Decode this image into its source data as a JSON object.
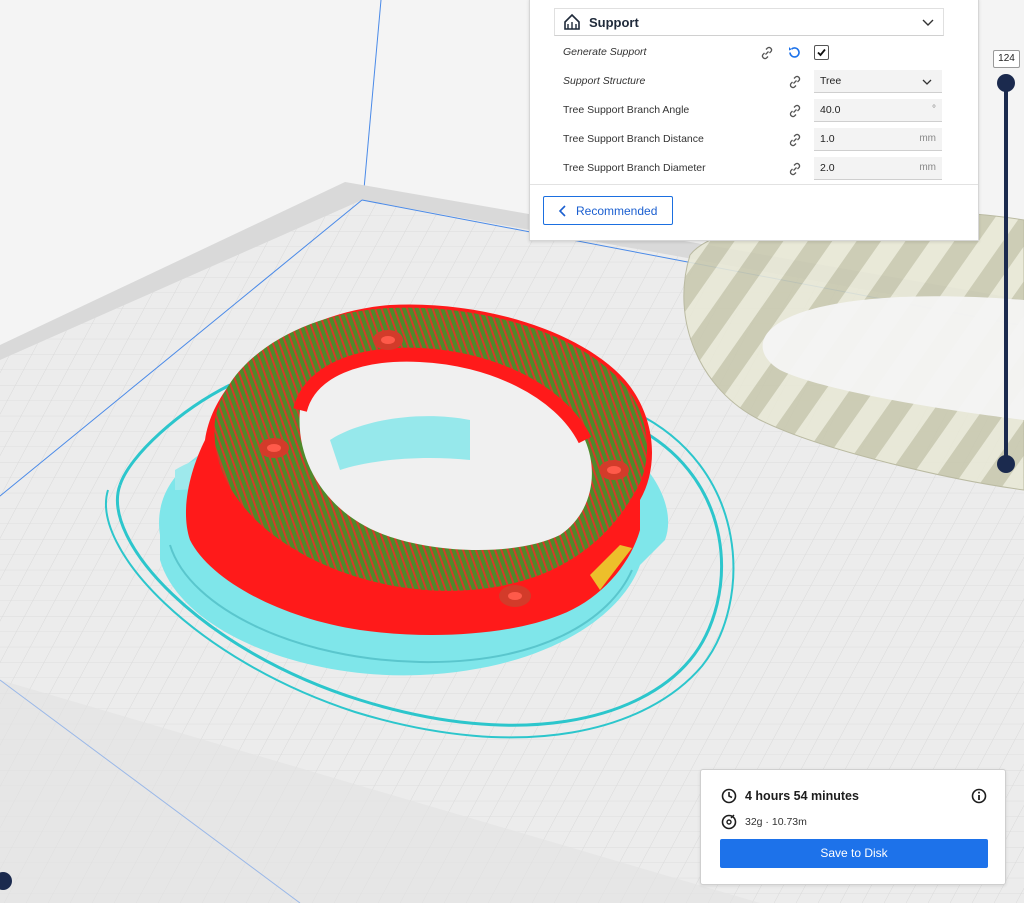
{
  "support_section": {
    "title": "Support",
    "icon": "support-icon",
    "settings": [
      {
        "label": "Generate Support",
        "italic": true,
        "type": "checkbox",
        "checked": true
      },
      {
        "label": "Support Structure",
        "italic": true,
        "type": "select",
        "value": "Tree"
      },
      {
        "label": "Tree Support Branch Angle",
        "italic": false,
        "type": "number",
        "value": "40.0",
        "unit": "°"
      },
      {
        "label": "Tree Support Branch Distance",
        "italic": false,
        "type": "number",
        "value": "1.0",
        "unit": "mm"
      },
      {
        "label": "Tree Support Branch Diameter",
        "italic": false,
        "type": "number",
        "value": "2.0",
        "unit": "mm"
      }
    ]
  },
  "recommended_button": {
    "label": "Recommended"
  },
  "layer_slider": {
    "current_layer": "124"
  },
  "print_info": {
    "time": "4 hours 54 minutes",
    "material": "32g · 10.73m",
    "save_label": "Save to Disk"
  },
  "colors": {
    "accent": "#1d72ea",
    "slider": "#1b2a4e",
    "wall": "#ff1a1a",
    "skin": "#4f8a2b",
    "support": "#7fe6ea",
    "skirt": "#2cc6cc"
  }
}
